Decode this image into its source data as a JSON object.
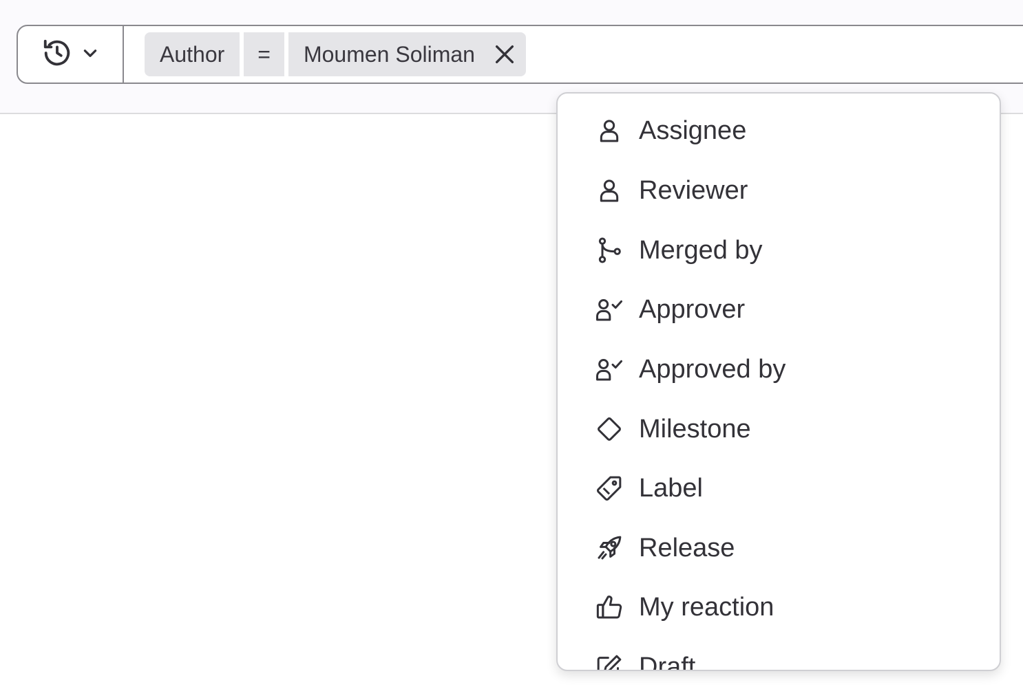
{
  "filter_bar": {
    "tokens": {
      "field": "Author",
      "operator": "=",
      "value": "Moumen Soliman"
    }
  },
  "dropdown": {
    "items": [
      {
        "label": "Assignee",
        "icon": "user-icon"
      },
      {
        "label": "Reviewer",
        "icon": "user-icon"
      },
      {
        "label": "Merged by",
        "icon": "merge-icon"
      },
      {
        "label": "Approver",
        "icon": "user-check-icon"
      },
      {
        "label": "Approved by",
        "icon": "user-check-icon"
      },
      {
        "label": "Milestone",
        "icon": "milestone-icon"
      },
      {
        "label": "Label",
        "icon": "label-icon"
      },
      {
        "label": "Release",
        "icon": "rocket-icon"
      },
      {
        "label": "My reaction",
        "icon": "thumb-up-icon"
      },
      {
        "label": "Draft",
        "icon": "pencil-square-icon"
      }
    ]
  }
}
